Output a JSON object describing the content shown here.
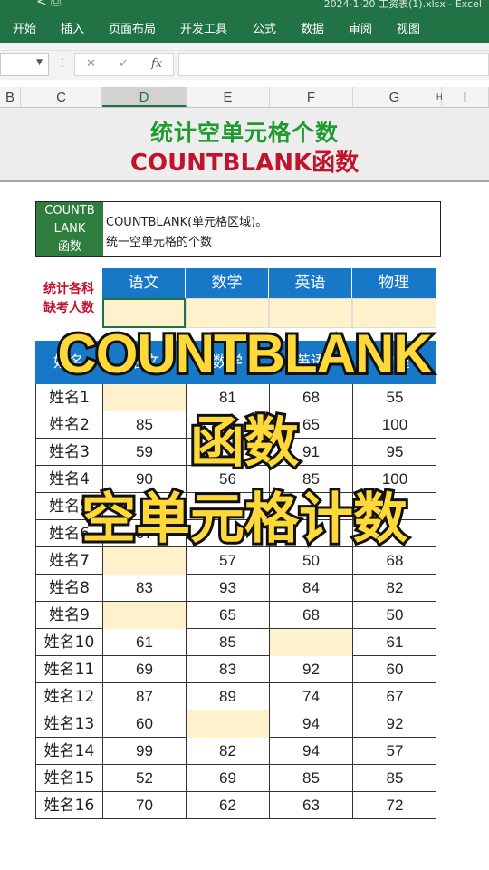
{
  "title_bar": {
    "icons": "<  ⎙",
    "text": "2024-1-20 工资表(1).xlsx  -  Excel"
  },
  "ribbon": {
    "tabs": [
      "开始",
      "插入",
      "页面布局",
      "开发工具",
      "公式",
      "数据",
      "审阅",
      "视图"
    ]
  },
  "formula_bar": {
    "name_box": "",
    "cancel_icon": "✕",
    "enter_icon": "✓",
    "fx_label": "fx",
    "formula": ""
  },
  "columns": [
    "B",
    "C",
    "D",
    "E",
    "F",
    "G",
    "H",
    "I"
  ],
  "selected_column": "D",
  "banner": {
    "title": "统计空单元格个数",
    "subtitle": "COUNTBLANK函数"
  },
  "description": {
    "fn_name_lines": [
      "COUNTB",
      "LANK",
      "函数"
    ],
    "syntax": "COUNTBLANK(单元格区域)。",
    "meaning": "统一空单元格的个数"
  },
  "absent": {
    "label_lines": [
      "统计各科",
      "缺考人数"
    ],
    "subjects": [
      "语文",
      "数学",
      "英语",
      "物理"
    ],
    "counts": [
      "",
      "",
      "",
      ""
    ]
  },
  "score_table": {
    "header": [
      "姓名",
      "语文",
      "数学",
      "英语",
      "物理"
    ],
    "rows": [
      [
        "姓名1",
        "",
        "81",
        "68",
        "55"
      ],
      [
        "姓名2",
        "85",
        "",
        "65",
        "100"
      ],
      [
        "姓名3",
        "59",
        "",
        "91",
        "95"
      ],
      [
        "姓名4",
        "90",
        "56",
        "85",
        "100"
      ],
      [
        "姓名5",
        "",
        "",
        "",
        ""
      ],
      [
        "姓名6",
        "57",
        "",
        "",
        ""
      ],
      [
        "姓名7",
        "",
        "57",
        "50",
        "68"
      ],
      [
        "姓名8",
        "83",
        "93",
        "84",
        "82"
      ],
      [
        "姓名9",
        "",
        "65",
        "68",
        "50"
      ],
      [
        "姓名10",
        "61",
        "85",
        "",
        "61"
      ],
      [
        "姓名11",
        "69",
        "83",
        "92",
        "60"
      ],
      [
        "姓名12",
        "87",
        "89",
        "74",
        "67"
      ],
      [
        "姓名13",
        "60",
        "",
        "94",
        "92"
      ],
      [
        "姓名14",
        "99",
        "82",
        "94",
        "57"
      ],
      [
        "姓名15",
        "52",
        "69",
        "85",
        "85"
      ],
      [
        "姓名16",
        "70",
        "62",
        "63",
        "72"
      ]
    ],
    "blank_cells": [
      [
        0,
        1
      ],
      [
        6,
        1
      ],
      [
        8,
        1
      ],
      [
        9,
        3
      ],
      [
        12,
        2
      ]
    ]
  },
  "overlay": {
    "line1": "COUNTBLANK",
    "line2": "函数",
    "line3": "空单元格计数"
  },
  "colors": {
    "excel_green": "#217346",
    "header_blue": "#1878c8",
    "blank_fill": "#fff1cc",
    "title_green": "#1f9b2f",
    "title_red": "#c0132c",
    "caption_yellow": "#ffd93a"
  }
}
